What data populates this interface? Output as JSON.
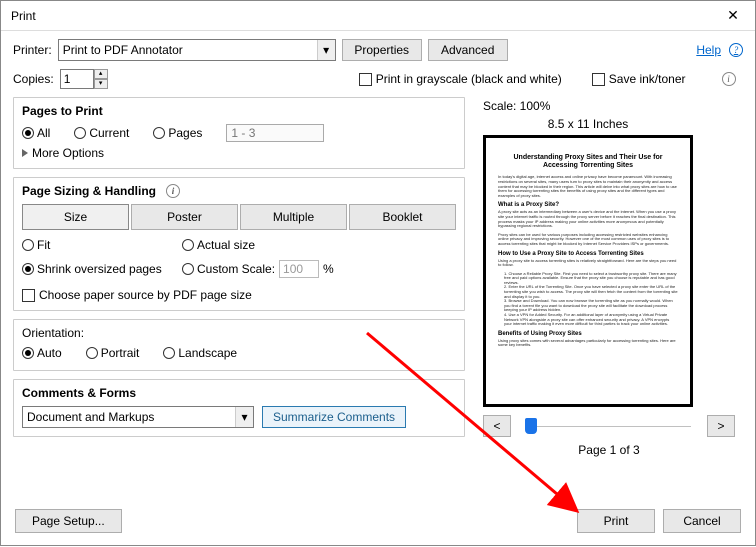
{
  "window": {
    "title": "Print"
  },
  "header": {
    "printer_label": "Printer:",
    "printer_value": "Print to PDF Annotator",
    "properties_btn": "Properties",
    "advanced_btn": "Advanced",
    "help_label": "Help",
    "copies_label": "Copies:",
    "copies_value": "1",
    "grayscale_label": "Print in grayscale (black and white)",
    "save_ink_label": "Save ink/toner"
  },
  "pages": {
    "title": "Pages to Print",
    "all": "All",
    "current": "Current",
    "pages": "Pages",
    "range_placeholder": "1 - 3",
    "more_options": "More Options"
  },
  "sizing": {
    "title": "Page Sizing & Handling",
    "size": "Size",
    "poster": "Poster",
    "multiple": "Multiple",
    "booklet": "Booklet",
    "fit": "Fit",
    "actual": "Actual size",
    "shrink": "Shrink oversized pages",
    "custom": "Custom Scale:",
    "custom_value": "100",
    "percent": "%",
    "choose_paper": "Choose paper source by PDF page size"
  },
  "orientation": {
    "title": "Orientation:",
    "auto": "Auto",
    "portrait": "Portrait",
    "landscape": "Landscape"
  },
  "comments": {
    "title": "Comments & Forms",
    "value": "Document and Markups",
    "summarize": "Summarize Comments"
  },
  "footer": {
    "page_setup": "Page Setup...",
    "print": "Print",
    "cancel": "Cancel"
  },
  "preview": {
    "scale": "Scale: 100%",
    "dimensions": "8.5 x 11 Inches",
    "page_indicator": "Page 1 of 3",
    "doc_title": "Understanding Proxy Sites and Their Use for Accessing Torrenting Sites",
    "sub1": "What is a Proxy Site?",
    "sub2": "How to Use a Proxy Site to Access Torrenting Sites",
    "sub3": "Benefits of Using Proxy Sites"
  }
}
